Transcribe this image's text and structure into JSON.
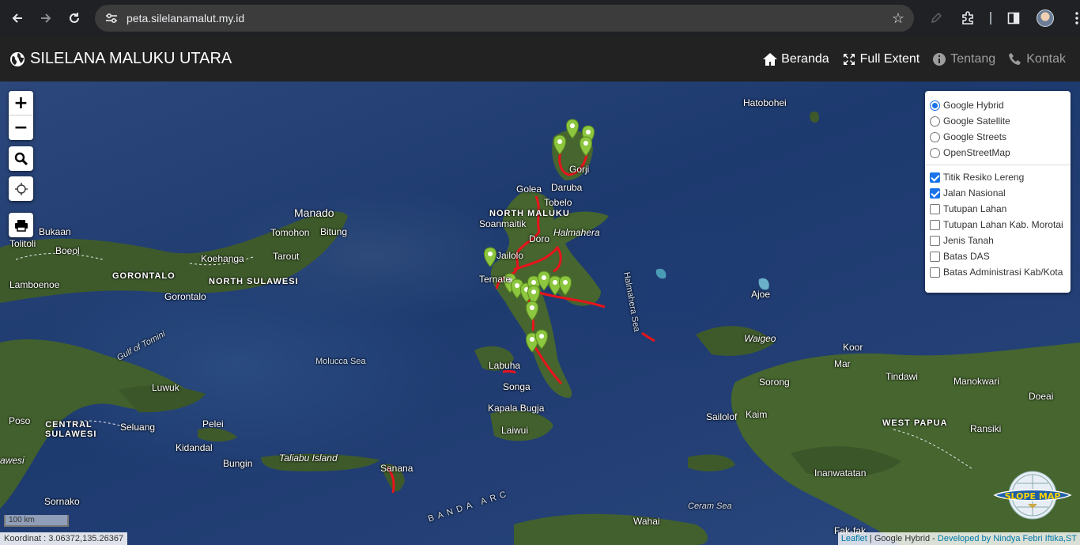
{
  "browser": {
    "url": "peta.silelanamalut.my.id"
  },
  "navbar": {
    "brand": "SILELANA MALUKU UTARA",
    "menu": [
      {
        "label": "Beranda",
        "icon": "home-icon"
      },
      {
        "label": "Full Extent",
        "icon": "expand-icon"
      },
      {
        "label": "Tentang",
        "icon": "info-icon"
      },
      {
        "label": "Kontak",
        "icon": "phone-icon"
      }
    ]
  },
  "map": {
    "zoom_in": "+",
    "zoom_out": "−",
    "places": {
      "hatobohei": "Hatobohei",
      "manado": "Manado",
      "bukaan": "Bukaan",
      "tomohon": "Tomohon",
      "bitung": "Bitung",
      "tolitoli": "Tolitoli",
      "boeol": "Boeol",
      "tarout": "Tarout",
      "koehanga": "Koehanga",
      "gorontalo_region": "GORONTALO",
      "north_sulawesi": "NORTH SULAWESI",
      "lamboenoe": "Lamboenoe",
      "gorontalo": "Gorontalo",
      "gulf_tomini": "Gulf of Tomini",
      "luwuk": "Luwuk",
      "molucca_sea": "Molucca Sea",
      "poso": "Poso",
      "central_sulawesi": "CENTRAL SULAWESI",
      "seluang": "Seluang",
      "pelei": "Pelei",
      "kidandal": "Kidandal",
      "bungin": "Bungin",
      "awesi": "awesi",
      "taliabu": "Taliabu Island",
      "sornako": "Sornako",
      "banda_arc": "BANDA ARC",
      "gorji": "Gorji",
      "daruba": "Daruba",
      "golea": "Golea",
      "tobelo": "Tobelo",
      "north_maluku": "NORTH MALUKU",
      "soanmaitik": "Soanmaitik",
      "halmahera": "Halmahera",
      "doro": "Doro",
      "jailolo": "Jailolo",
      "ternate": "Ternate",
      "halmahera_sea": "Halmahera Sea",
      "ajoe": "Ajoe",
      "waigeo": "Waigeo",
      "koor": "Koor",
      "mar": "Mar",
      "tindawi": "Tindawi",
      "manokwari": "Manokwari",
      "doeai": "Doeai",
      "sorong": "Sorong",
      "sailolof": "Sailolof",
      "kaim": "Kaim",
      "west_papua": "WEST PAPUA",
      "ransiki": "Ransiki",
      "labuha": "Labuha",
      "songa": "Songa",
      "kapala_bugja": "Kapala Bugja",
      "laiwui": "Laiwui",
      "sanana": "Sanana",
      "inanwatatan": "Inanwatatan",
      "ceram_sea": "Ceram Sea",
      "wahai": "Wahai",
      "fak_fak": "Fak-fak"
    }
  },
  "layers": {
    "base": [
      {
        "label": "Google Hybrid",
        "checked": true
      },
      {
        "label": "Google Satellite",
        "checked": false
      },
      {
        "label": "Google Streets",
        "checked": false
      },
      {
        "label": "OpenStreetMap",
        "checked": false
      }
    ],
    "overlays": [
      {
        "label": "Titik Resiko Lereng",
        "checked": true
      },
      {
        "label": "Jalan Nasional",
        "checked": true
      },
      {
        "label": "Tutupan Lahan",
        "checked": false
      },
      {
        "label": "Tutupan Lahan Kab. Morotai",
        "checked": false
      },
      {
        "label": "Jenis Tanah",
        "checked": false
      },
      {
        "label": "Batas DAS",
        "checked": false
      },
      {
        "label": "Batas Administrasi Kab/Kota",
        "checked": false
      }
    ]
  },
  "footer": {
    "scale": "100 km",
    "coordinate": "Koordinat : 3.06372,135.26367",
    "attrib_leaflet": "Leaflet",
    "attrib_sep": " | Google Hybrid - ",
    "attrib_dev": "Developed by Nindya Febri Iftika,ST"
  },
  "logo": {
    "text": "SLOPE MAP"
  },
  "colors": {
    "road": "#e8141b",
    "marker": "#8dc63f",
    "land": "#3d5a2a",
    "navbar": "#222222"
  }
}
